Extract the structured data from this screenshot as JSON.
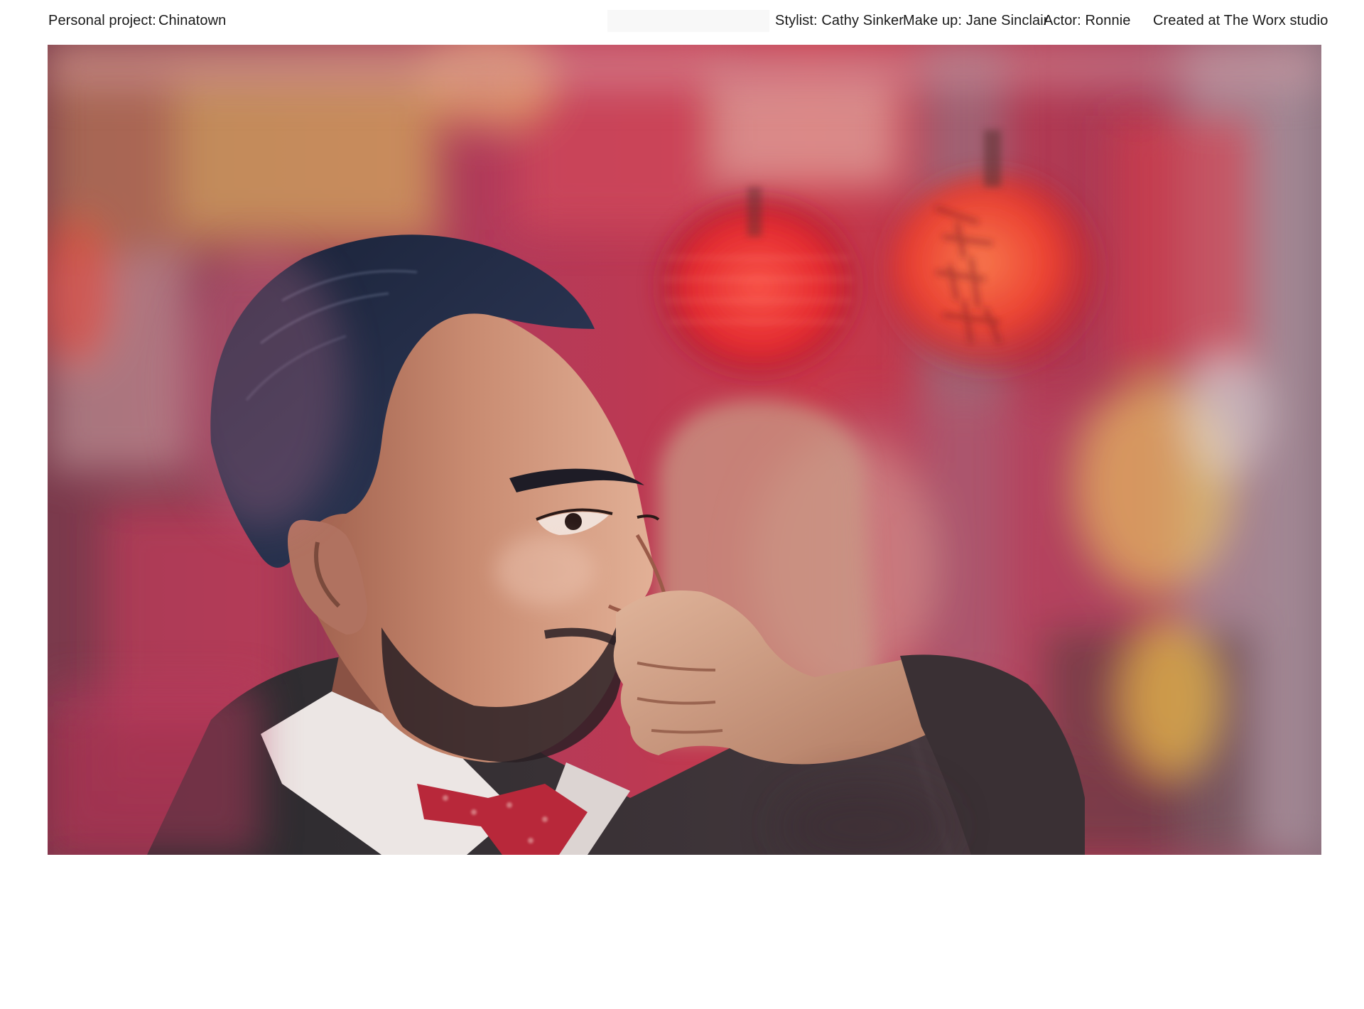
{
  "header": {
    "project_label": "Personal project:",
    "project_name": "Chinatown",
    "stylist": "Stylist: Cathy Sinker",
    "makeup": "Make up: Jane Sinclair",
    "actor": "Actor: Ronnie",
    "studio": "Created at The Worx studio"
  },
  "colors": {
    "background": "#ffffff",
    "text": "#1a1a1a",
    "lantern_red": "#e8282c",
    "backdrop_magenta": "#b83a5e"
  }
}
